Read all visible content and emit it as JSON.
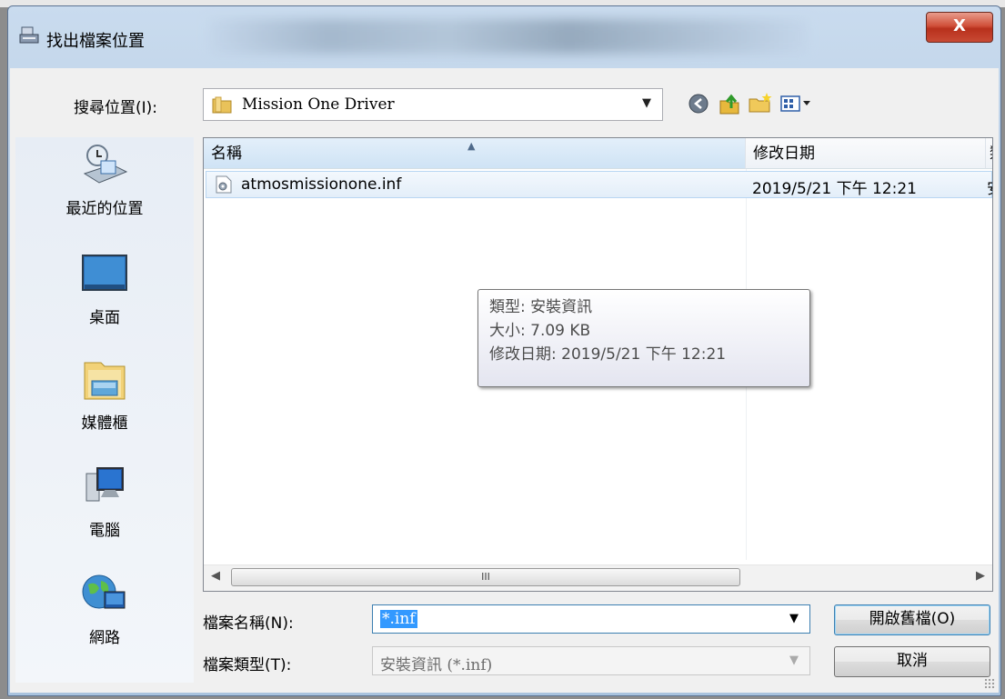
{
  "window": {
    "title": "找出檔案位置",
    "close_label": "X"
  },
  "lookin": {
    "label": "搜尋位置(I):",
    "value": "Mission One Driver",
    "toolbar_icons": [
      "back-icon",
      "up-folder-icon",
      "new-folder-icon",
      "view-menu-icon"
    ]
  },
  "places": [
    {
      "label": "最近的位置",
      "icon": "recent-places-icon"
    },
    {
      "label": "桌面",
      "icon": "desktop-icon"
    },
    {
      "label": "媒體櫃",
      "icon": "libraries-icon"
    },
    {
      "label": "電腦",
      "icon": "computer-icon"
    },
    {
      "label": "網路",
      "icon": "network-icon"
    }
  ],
  "list": {
    "columns": [
      "名稱",
      "修改日期",
      "類"
    ],
    "rows": [
      {
        "name": "atmosmissionone.inf",
        "modified": "2019/5/21 下午 12:21",
        "type_fragment": "安"
      }
    ],
    "tooltip": [
      "類型: 安裝資訊",
      "大小: 7.09 KB",
      "修改日期: 2019/5/21 下午 12:21"
    ],
    "scroll_thumb": "III"
  },
  "form": {
    "filename_label": "檔案名稱(N):",
    "filename_value": "*.inf",
    "filetype_label": "檔案類型(T):",
    "filetype_value": "安裝資訊 (*.inf)",
    "open_label": "開啟舊檔(O)",
    "cancel_label": "取消"
  },
  "colors": {
    "selection": "#3399ff",
    "close_button": "#c84a34",
    "title_bar": "#b6cce4"
  }
}
